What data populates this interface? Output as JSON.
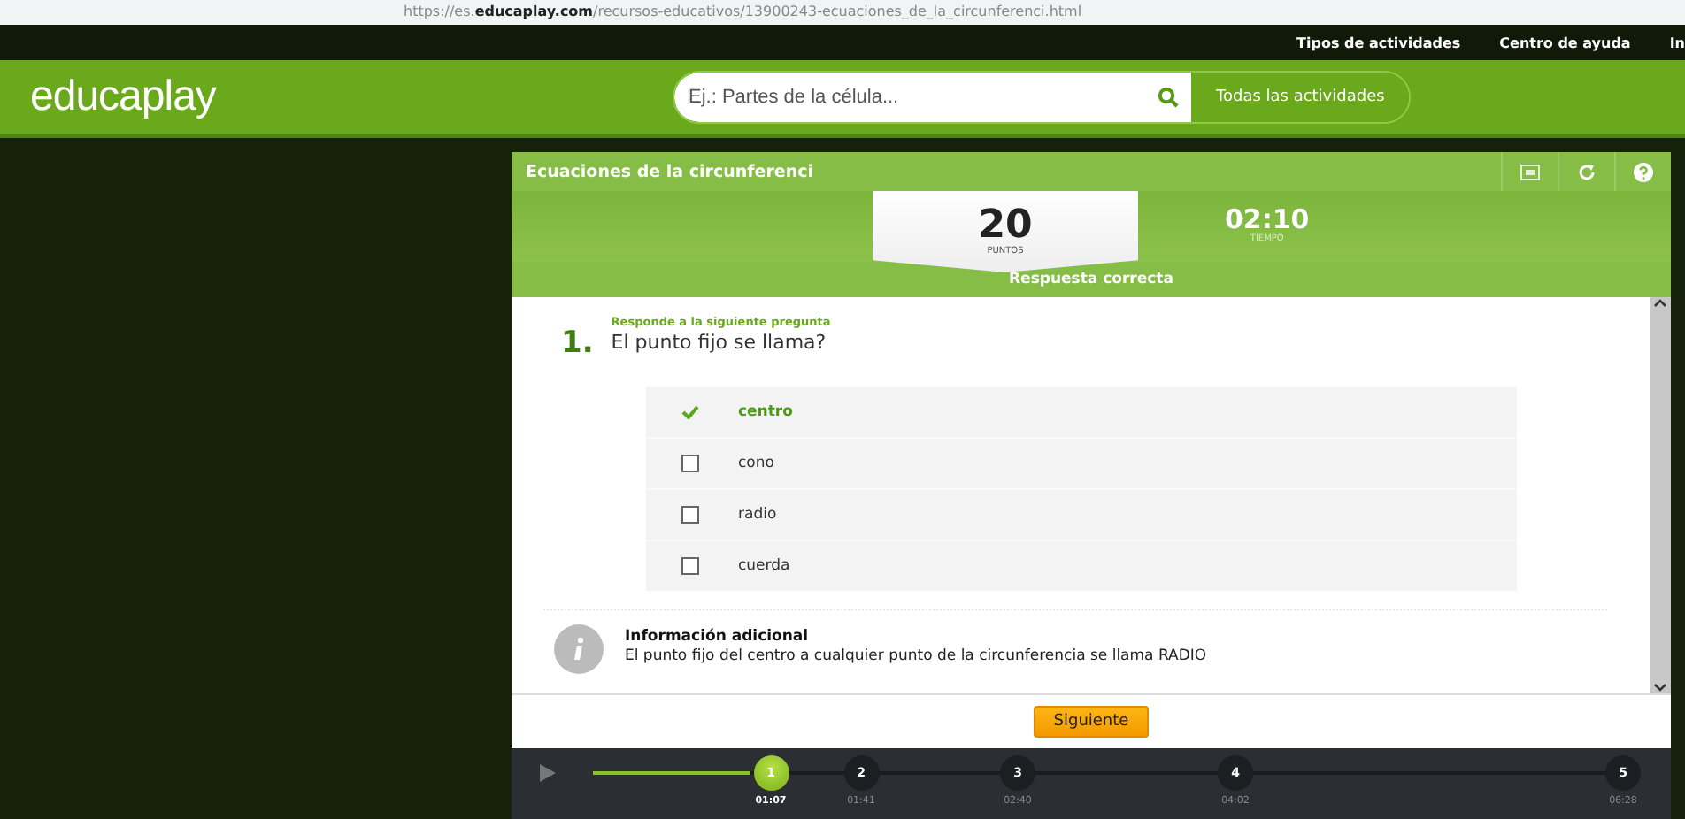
{
  "browser": {
    "url": "https://es.**educaplay.com**/recursos-educativos/13900243-ecuaciones_de_la_circunferenci.html"
  },
  "top_links": [
    "Tipos de actividades",
    "Centro de ayuda",
    "In"
  ],
  "header": {
    "logo": "educaplay",
    "search": {
      "placeholder": "Ej.: Partes de la célula..."
    },
    "all_button": "Todas las actividades"
  },
  "quiz": {
    "title": "Ecuaciones de la circunferenci",
    "score": {
      "value": "20",
      "label": "PUNTOS"
    },
    "timer": {
      "value": "02:10",
      "label": "TIEMPO"
    },
    "feedback": "Respuesta correcta",
    "question": {
      "number": "1.",
      "instruction": "Responde a la siguiente pregunta",
      "text": "El punto fijo se llama?"
    },
    "options": [
      {
        "label": "centro",
        "correct": true
      },
      {
        "label": "cono",
        "correct": false
      },
      {
        "label": "radio",
        "correct": false
      },
      {
        "label": "cuerda",
        "correct": false
      }
    ],
    "info": {
      "title": "Información adicional",
      "text": "El punto fijo del centro a cualquier punto de la circunferencia se llama RADIO"
    },
    "next_button": "Siguiente",
    "timeline": {
      "level": 0.17,
      "markers": [
        {
          "label": "1",
          "time": "01:07",
          "selected": true
        },
        {
          "label": "2",
          "time": "01:41",
          "selected": false
        },
        {
          "label": "3",
          "time": "02:40",
          "selected": false
        },
        {
          "label": "4",
          "time": "04:02",
          "selected": false
        },
        {
          "label": "5",
          "time": "06:28",
          "selected": false
        }
      ]
    }
  }
}
